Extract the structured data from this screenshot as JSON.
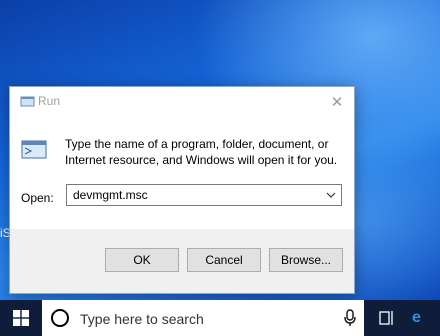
{
  "desktop": {
    "edge_text": "iS"
  },
  "dialog": {
    "title": "Run",
    "description": "Type the name of a program, folder, document, or Internet resource, and Windows will open it for you.",
    "open_label": "Open:",
    "open_value": "devmgmt.msc",
    "buttons": {
      "ok": "OK",
      "cancel": "Cancel",
      "browse": "Browse..."
    },
    "icons": {
      "title": "run-icon",
      "body": "run-icon",
      "close": "close-icon",
      "dropdown": "chevron-down-icon"
    }
  },
  "taskbar": {
    "search_placeholder": "Type here to search",
    "icons": [
      "windows-start-icon",
      "search-icon",
      "microphone-icon",
      "task-view-icon",
      "edge-icon"
    ]
  },
  "colors": {
    "taskbar": "#0f1d3a",
    "desktop_accent": "#1565d8"
  }
}
